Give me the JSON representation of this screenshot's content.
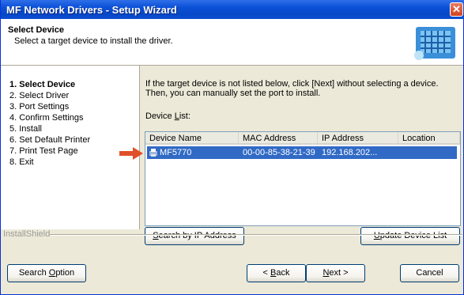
{
  "window": {
    "title": "MF Network Drivers - Setup Wizard",
    "close_glyph": "✕"
  },
  "header": {
    "title": "Select Device",
    "subtitle": "Select a target device to install the driver."
  },
  "steps": [
    "1.  Select Device",
    "2.  Select Driver",
    "3.  Port Settings",
    "4.  Confirm Settings",
    "5.  Install",
    "6.  Set Default Printer",
    "7.  Print Test Page",
    "8.  Exit"
  ],
  "main": {
    "instruction": "If the target device is not listed below, click [Next] without selecting a device. Then, you can manually set the port to install.",
    "device_list_label_pre": "Device ",
    "device_list_label_key": "L",
    "device_list_label_post": "ist:",
    "columns": [
      "Device Name",
      "MAC Address",
      "IP Address",
      "Location"
    ],
    "rows": [
      {
        "device": "MF5770",
        "mac": "00-00-85-38-21-39",
        "ip": "192.168.202...",
        "location": ""
      }
    ]
  },
  "buttons": {
    "search_ip_key": "S",
    "search_ip_rest": "earch by IP Address",
    "update_key": "U",
    "update_rest": "pdate Device List",
    "search_option_pre": "Search ",
    "search_option_key": "O",
    "search_option_rest": "ption",
    "back_pre": "< ",
    "back_key": "B",
    "back_rest": "ack",
    "next_key": "N",
    "next_rest": "ext >",
    "cancel": "Cancel"
  },
  "footer": {
    "installshield": "InstallShield"
  },
  "colors": {
    "title_bar": "#0A50D6",
    "selection": "#316AC5",
    "arrow": "#E0502A"
  }
}
